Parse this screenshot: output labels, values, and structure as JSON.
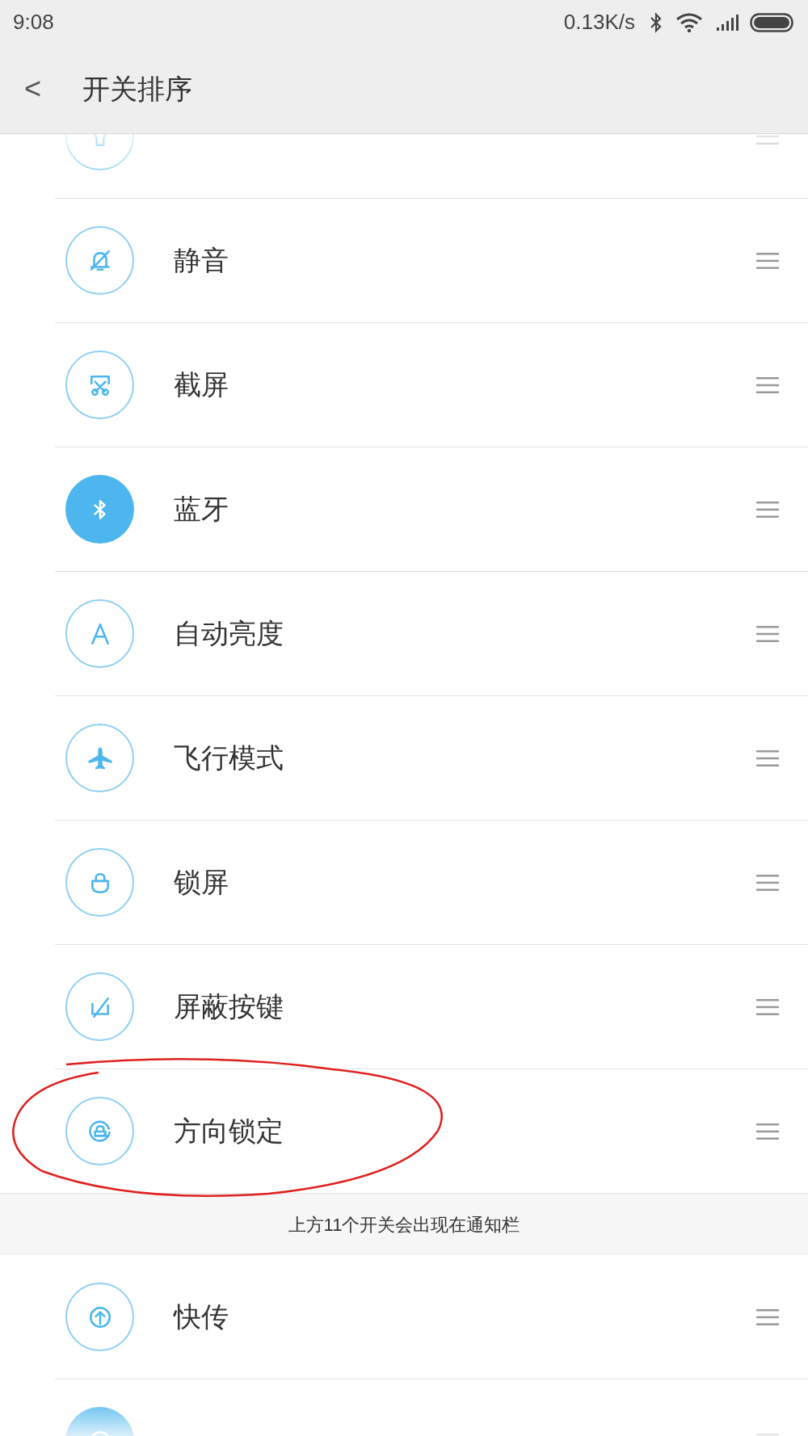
{
  "status_bar": {
    "time": "9:08",
    "speed": "0.13K/s"
  },
  "header": {
    "back": "<",
    "title": "开关排序"
  },
  "toggles": [
    {
      "on": false
    },
    {
      "label": "静音",
      "on": false
    },
    {
      "label": "截屏",
      "on": false
    },
    {
      "label": "蓝牙",
      "on": true
    },
    {
      "label": "自动亮度",
      "on": false
    },
    {
      "label": "飞行模式",
      "on": false
    },
    {
      "label": "锁屏",
      "on": false
    },
    {
      "label": "屏蔽按键",
      "on": false
    },
    {
      "label": "方向锁定",
      "on": false
    }
  ],
  "section_note": "上方11个开关会出现在通知栏",
  "more_toggles": [
    {
      "label": "快传",
      "on": false
    },
    {
      "on": true
    }
  ]
}
